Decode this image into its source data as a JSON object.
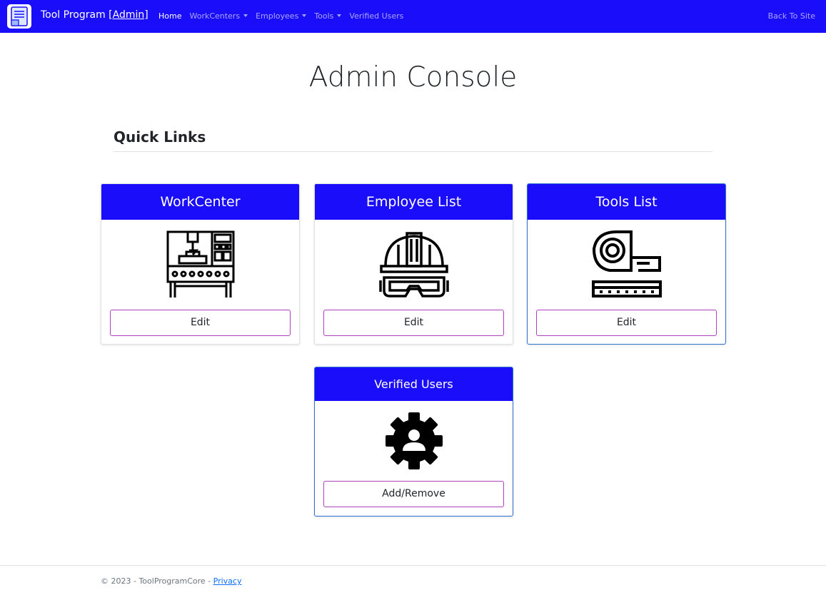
{
  "navbar": {
    "brand_text": "Tool Program ",
    "brand_admin": "[Admin]",
    "links": [
      {
        "label": "Home",
        "active": true
      },
      {
        "label": "WorkCenters",
        "dropdown": true
      },
      {
        "label": "Employees",
        "dropdown": true
      },
      {
        "label": "Tools",
        "dropdown": true
      },
      {
        "label": "Verified Users"
      }
    ],
    "back_link": "Back To Site",
    "color": "#1a0dfa"
  },
  "page": {
    "title": "Admin Console",
    "section_title": "Quick Links"
  },
  "cards": [
    {
      "title": "WorkCenter",
      "icon": "cnc-machine-icon",
      "button": "Edit"
    },
    {
      "title": "Employee List",
      "icon": "hard-hat-goggles-icon",
      "button": "Edit"
    },
    {
      "title": "Tools List",
      "icon": "tape-measure-icon",
      "button": "Edit"
    },
    {
      "title": "Verified Users",
      "icon": "user-gear-icon",
      "button": "Add/Remove"
    }
  ],
  "footer": {
    "text": "© 2023 - ToolProgramCore - ",
    "privacy": "Privacy"
  }
}
